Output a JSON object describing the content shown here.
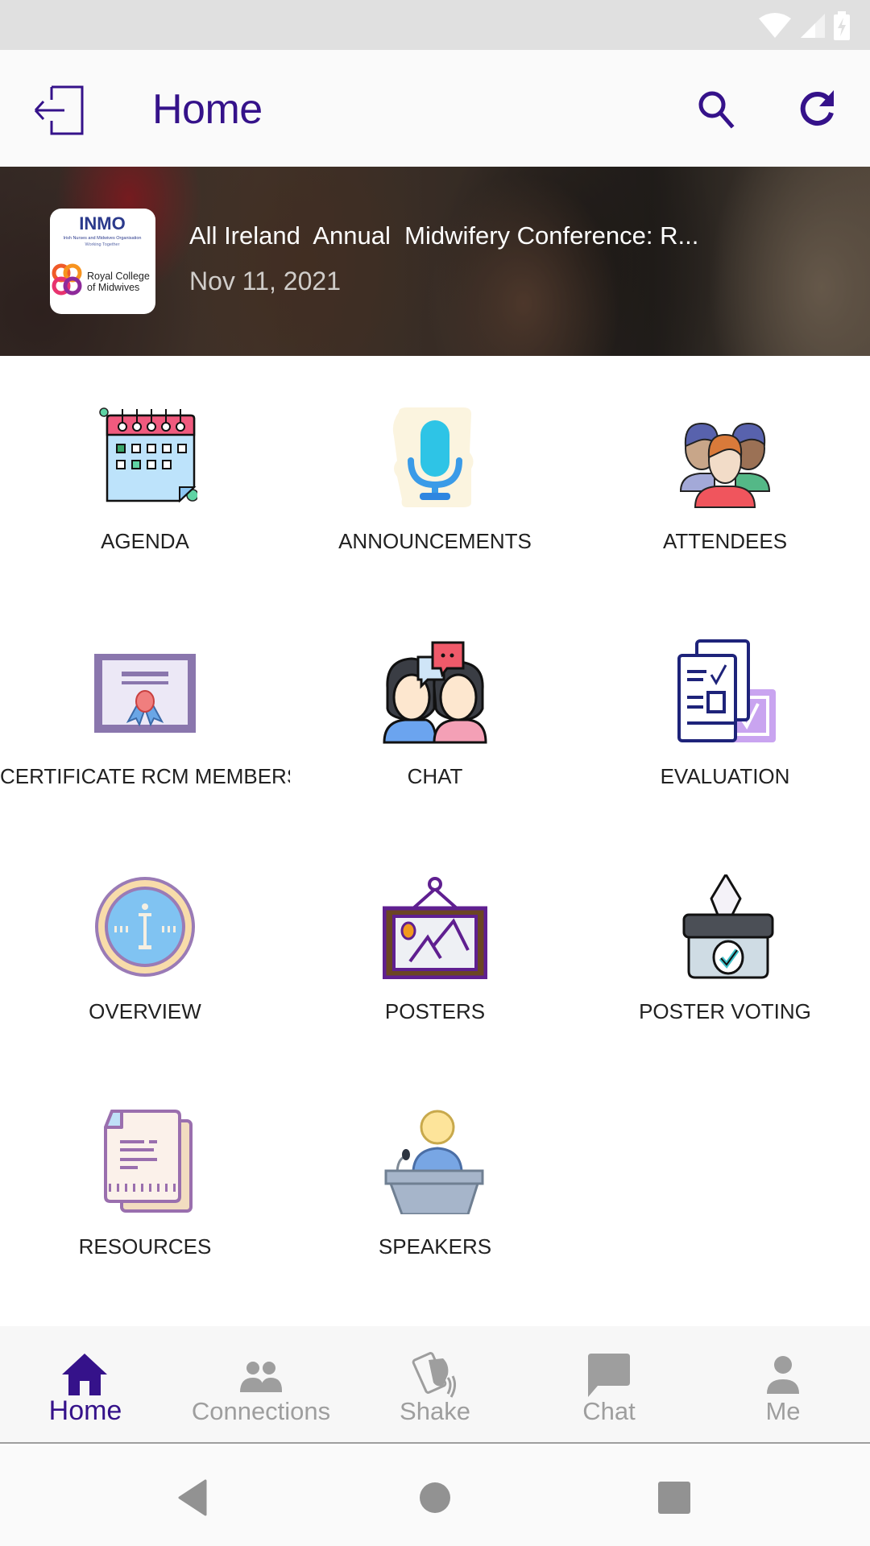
{
  "status_bar": {
    "icons": [
      "wifi-icon",
      "cell-signal-icon",
      "battery-charging-icon"
    ]
  },
  "app_bar": {
    "title": "Home",
    "left_icon": "logout-icon",
    "actions": [
      "search-icon",
      "refresh-icon"
    ]
  },
  "event": {
    "title": "All Ireland  Annual  Midwifery Conference: R...",
    "date": "Nov 11, 2021",
    "logo": {
      "org1": "INMO",
      "org1_sub": "Irish Nurses and Midwives Organisation",
      "org1_tag": "Working Together",
      "org2_line1": "Royal College",
      "org2_line2": "of Midwives"
    }
  },
  "tiles": [
    {
      "label": "AGENDA",
      "icon": "calendar-icon"
    },
    {
      "label": "ANNOUNCEMENTS",
      "icon": "microphone-icon"
    },
    {
      "label": "ATTENDEES",
      "icon": "people-group-icon"
    },
    {
      "label": "CERTIFICATE RCM MEMBERS",
      "icon": "certificate-icon"
    },
    {
      "label": "CHAT",
      "icon": "chat-people-icon"
    },
    {
      "label": "EVALUATION",
      "icon": "checklist-icon"
    },
    {
      "label": "OVERVIEW",
      "icon": "info-badge-icon"
    },
    {
      "label": "POSTERS",
      "icon": "framed-picture-icon"
    },
    {
      "label": "POSTER VOTING",
      "icon": "ballot-box-icon"
    },
    {
      "label": "RESOURCES",
      "icon": "documents-icon"
    },
    {
      "label": "SPEAKERS",
      "icon": "podium-speaker-icon"
    }
  ],
  "bottom_nav": {
    "active": "Home",
    "items": [
      {
        "label": "Home",
        "icon": "home-icon"
      },
      {
        "label": "Connections",
        "icon": "people-icon"
      },
      {
        "label": "Shake",
        "icon": "shake-phone-icon"
      },
      {
        "label": "Chat",
        "icon": "chat-bubble-icon"
      },
      {
        "label": "Me",
        "icon": "person-icon"
      }
    ]
  },
  "colors": {
    "primary": "#35128a",
    "inactive": "#9e9e9e"
  }
}
